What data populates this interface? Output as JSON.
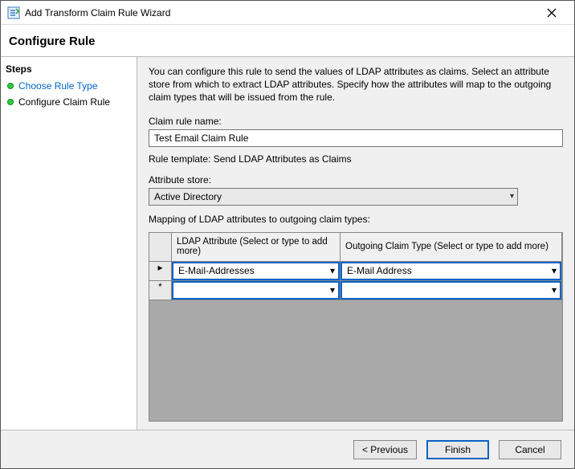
{
  "window": {
    "title": "Add Transform Claim Rule Wizard"
  },
  "heading": "Configure Rule",
  "sidebar": {
    "title": "Steps",
    "items": [
      {
        "label": "Choose Rule Type"
      },
      {
        "label": "Configure Claim Rule"
      }
    ]
  },
  "main": {
    "description": "You can configure this rule to send the values of LDAP attributes as claims. Select an attribute store from which to extract LDAP attributes. Specify how the attributes will map to the outgoing claim types that will be issued from the rule.",
    "claim_rule_name_label": "Claim rule name:",
    "claim_rule_name_value": "Test Email Claim Rule",
    "rule_template_label": "Rule template: Send LDAP Attributes as Claims",
    "attribute_store_label": "Attribute store:",
    "attribute_store_value": "Active Directory",
    "mapping_label": "Mapping of LDAP attributes to outgoing claim types:",
    "grid": {
      "col1_header": "LDAP Attribute (Select or type to add more)",
      "col2_header": "Outgoing Claim Type (Select or type to add more)",
      "rows": [
        {
          "marker": "▸",
          "ldap": "E-Mail-Addresses",
          "claim": "E-Mail Address"
        },
        {
          "marker": "*",
          "ldap": "",
          "claim": ""
        }
      ]
    }
  },
  "footer": {
    "previous": "< Previous",
    "finish": "Finish",
    "cancel": "Cancel"
  }
}
